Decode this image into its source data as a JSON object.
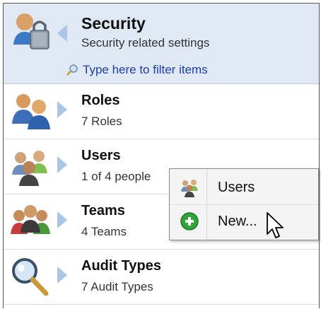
{
  "header": {
    "title": "Security",
    "subtitle": "Security related settings",
    "filter_label": "Type here to filter items",
    "icon": "security-lock-users-icon"
  },
  "items": [
    {
      "title": "Roles",
      "subtitle": "7 Roles",
      "icon": "roles-people-icon"
    },
    {
      "title": "Users",
      "subtitle": "1 of 4 people",
      "icon": "users-group-icon"
    },
    {
      "title": "Teams",
      "subtitle": "4 Teams",
      "icon": "teams-icon"
    },
    {
      "title": "Audit Types",
      "subtitle": "7 Audit Types",
      "icon": "audit-magnifier-icon"
    }
  ],
  "popup": {
    "items": [
      {
        "label": "Users",
        "icon": "users-group-icon"
      },
      {
        "label": "New...",
        "icon": "add-green-circle-icon"
      }
    ]
  },
  "colors": {
    "header_bg": "#dfe8f3",
    "link": "#1b3ea8",
    "arrow": "#a9c6e6",
    "add_green": "#2fa437"
  }
}
